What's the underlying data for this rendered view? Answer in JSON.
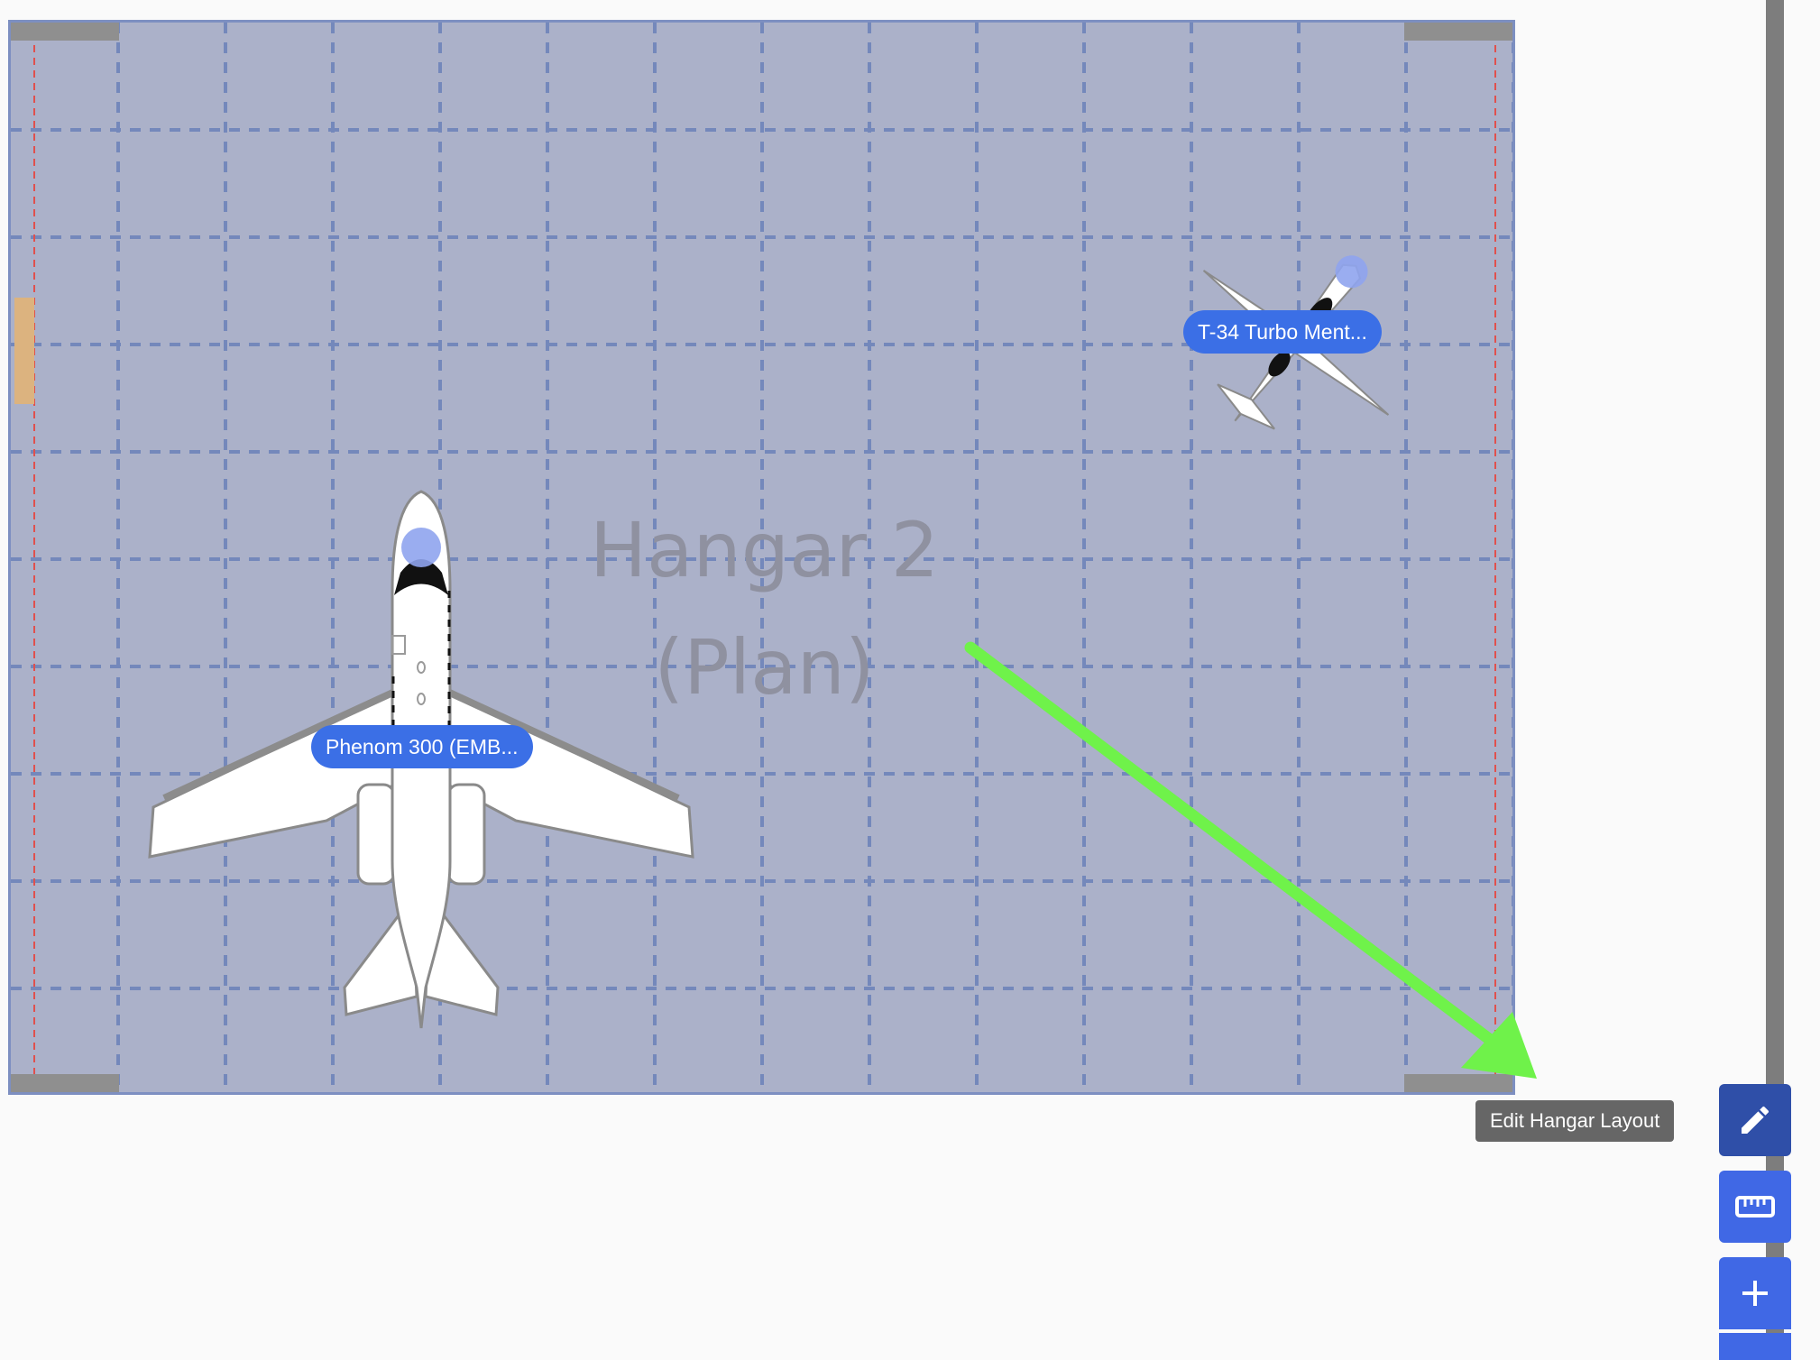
{
  "hangar": {
    "title_line1": "Hangar 2",
    "title_line2": "(Plan)"
  },
  "aircraft": [
    {
      "label": "Phenom 300 (EMB..."
    },
    {
      "label": "T-34 Turbo Ment..."
    }
  ],
  "toolbar": {
    "edit_tooltip": "Edit Hangar Layout",
    "edit_icon": "pencil-icon",
    "measure_icon": "ruler-icon",
    "add_icon": "plus-icon"
  },
  "colors": {
    "hangar_floor": "#abb1c9",
    "grid_line": "#7488bb",
    "label_bg": "#3b6fe6",
    "annotation_arrow": "#6ff24a",
    "door_marker": "#dcb37f"
  }
}
